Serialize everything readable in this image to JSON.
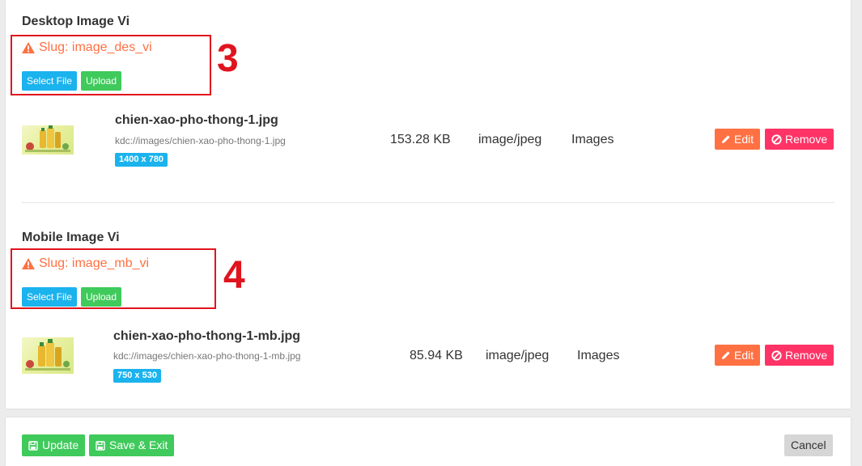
{
  "colors": {
    "accent_warning": "#ff7043",
    "select_blue": "#1bb3ee",
    "upload_green": "#3fca5b",
    "remove_pink": "#ff3366",
    "annotation_red": "#e0141e"
  },
  "sections": [
    {
      "title": "Desktop Image Vi",
      "slug_text": "Slug: image_des_vi",
      "annotation_number": "3",
      "select_label": "Select File",
      "upload_label": "Upload",
      "file": {
        "name": "chien-xao-pho-thong-1.jpg",
        "path": "kdc://images/chien-xao-pho-thong-1.jpg",
        "dimensions": "1400 x 780",
        "size": "153.28 KB",
        "mime": "image/jpeg",
        "category": "Images",
        "edit_label": "Edit",
        "remove_label": "Remove"
      }
    },
    {
      "title": "Mobile Image Vi",
      "slug_text": "Slug: image_mb_vi",
      "annotation_number": "4",
      "select_label": "Select File",
      "upload_label": "Upload",
      "file": {
        "name": "chien-xao-pho-thong-1-mb.jpg",
        "path": "kdc://images/chien-xao-pho-thong-1-mb.jpg",
        "dimensions": "750 x 530",
        "size": "85.94 KB",
        "mime": "image/jpeg",
        "category": "Images",
        "edit_label": "Edit",
        "remove_label": "Remove"
      }
    }
  ],
  "footer": {
    "update_label": "Update",
    "save_exit_label": "Save & Exit",
    "cancel_label": "Cancel"
  }
}
